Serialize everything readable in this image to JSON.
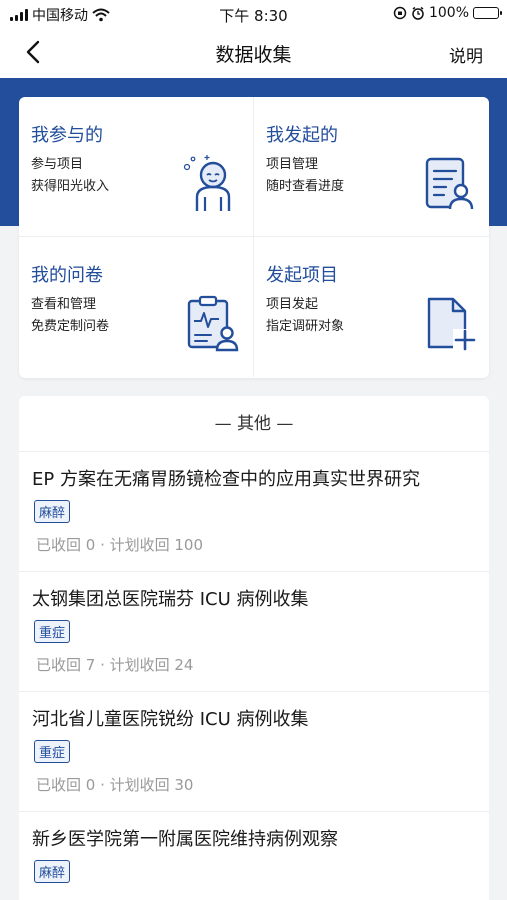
{
  "status_bar": {
    "carrier": "中国移动",
    "time": "下午 8:30",
    "battery": "100%"
  },
  "nav": {
    "title": "数据收集",
    "help_label": "说明"
  },
  "features": [
    {
      "title": "我参与的",
      "line1": "参与项目",
      "line2": "获得阳光收入",
      "icon": "participant-person-icon"
    },
    {
      "title": "我发起的",
      "line1": "项目管理",
      "line2": "随时查看进度",
      "icon": "document-user-icon"
    },
    {
      "title": "我的问卷",
      "line1": "查看和管理",
      "line2": "免费定制问卷",
      "icon": "clipboard-user-icon"
    },
    {
      "title": "发起项目",
      "line1": "项目发起",
      "line2": "指定调研对象",
      "icon": "new-file-plus-icon"
    }
  ],
  "other": {
    "header": "— 其他 —",
    "items": [
      {
        "title": "EP 方案在无痛胃肠镜检查中的应用真实世界研究",
        "tag": "麻醉",
        "stats": "已收回 0 · 计划收回 100"
      },
      {
        "title": "太钢集团总医院瑞芬 ICU 病例收集",
        "tag": "重症",
        "stats": "已收回 7 · 计划收回 24"
      },
      {
        "title": "河北省儿童医院锐纷 ICU 病例收集",
        "tag": "重症",
        "stats": "已收回 0 · 计划收回 30"
      },
      {
        "title": "新乡医学院第一附属医院维持病例观察",
        "tag": "麻醉",
        "stats": ""
      }
    ]
  },
  "colors": {
    "brand": "#234e9c",
    "background": "#f2f3f5"
  }
}
